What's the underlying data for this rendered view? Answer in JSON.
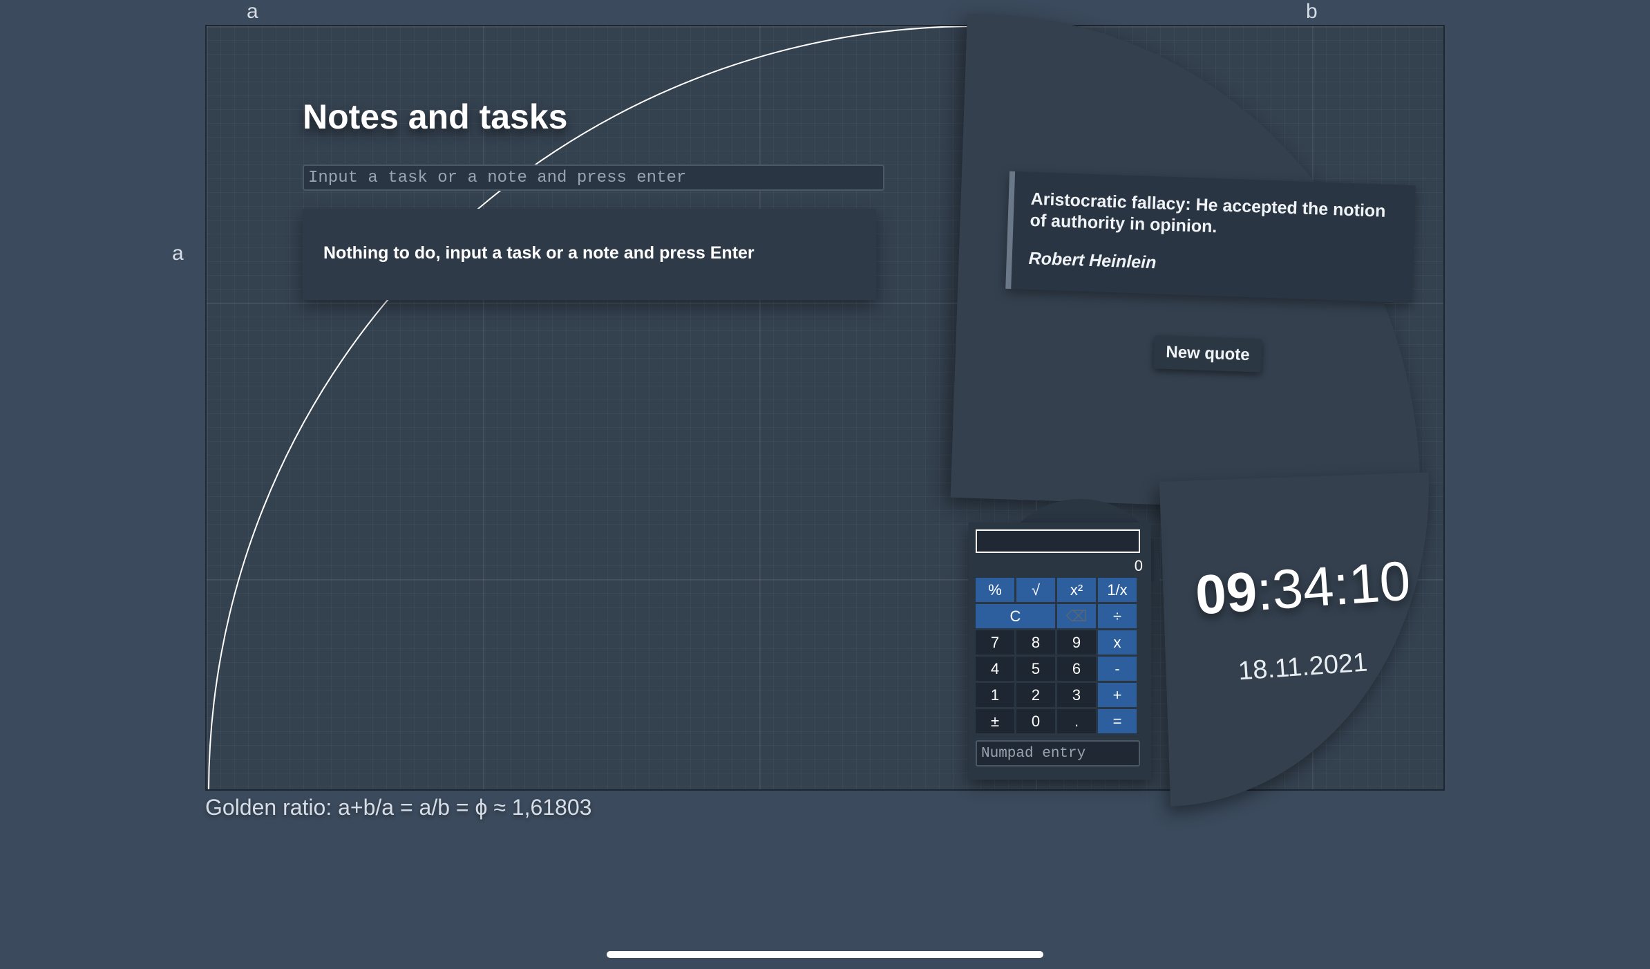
{
  "edge_labels": {
    "top_left": "a",
    "top_right": "b",
    "left": "a"
  },
  "notes": {
    "title": "Notes and tasks",
    "input_placeholder": "Input a task or a note and press enter",
    "empty_message": "Nothing to do, input a task or a note and press Enter"
  },
  "quote": {
    "text": "Aristocratic fallacy: He accepted the notion of authority in opinion.",
    "author": "Robert Heinlein",
    "new_quote_label": "New quote"
  },
  "calculator": {
    "result": "0",
    "keys": [
      {
        "label": "%",
        "kind": "fn"
      },
      {
        "label": "√",
        "kind": "fn"
      },
      {
        "label": "x²",
        "kind": "fn"
      },
      {
        "label": "1/x",
        "kind": "fn"
      },
      {
        "label": "C",
        "kind": "fn wide"
      },
      {
        "label": "⌫",
        "kind": "fn muted"
      },
      {
        "label": "÷",
        "kind": "op"
      },
      {
        "label": "7",
        "kind": "num"
      },
      {
        "label": "8",
        "kind": "num"
      },
      {
        "label": "9",
        "kind": "num"
      },
      {
        "label": "x",
        "kind": "op"
      },
      {
        "label": "4",
        "kind": "num"
      },
      {
        "label": "5",
        "kind": "num"
      },
      {
        "label": "6",
        "kind": "num"
      },
      {
        "label": "-",
        "kind": "op"
      },
      {
        "label": "1",
        "kind": "num"
      },
      {
        "label": "2",
        "kind": "num"
      },
      {
        "label": "3",
        "kind": "num"
      },
      {
        "label": "+",
        "kind": "op"
      },
      {
        "label": "±",
        "kind": "num"
      },
      {
        "label": "0",
        "kind": "num"
      },
      {
        "label": ".",
        "kind": "num"
      },
      {
        "label": "=",
        "kind": "op"
      }
    ],
    "numpad_placeholder": "Numpad entry"
  },
  "clock": {
    "hours": "09",
    "rest": ":34:10",
    "date": "18.11.2021"
  },
  "caption": "Golden ratio: a+b/a = a/b = ϕ ≈ 1,61803",
  "colors": {
    "background": "#3b4a5c",
    "panel": "#34404e",
    "calc_accent": "#2d5f9e"
  }
}
